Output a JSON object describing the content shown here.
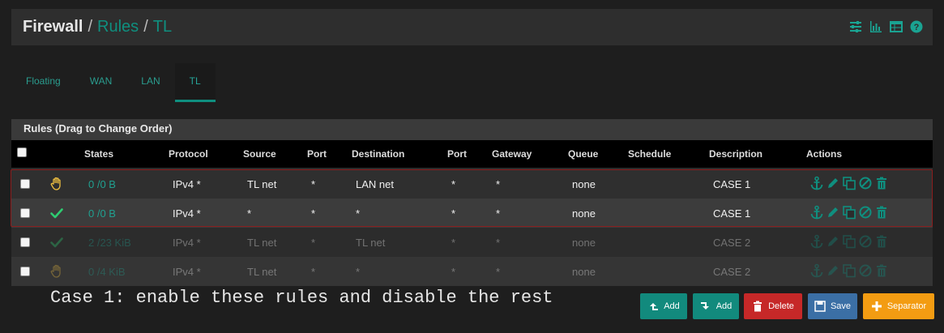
{
  "breadcrumb": {
    "first": "Firewall",
    "second": "Rules",
    "third": "TL",
    "sep": "/"
  },
  "header_icons": [
    "sliders-icon",
    "bar-chart-icon",
    "table-icon",
    "help-icon"
  ],
  "tabs": [
    {
      "label": "Floating"
    },
    {
      "label": "WAN"
    },
    {
      "label": "LAN"
    },
    {
      "label": "TL"
    }
  ],
  "panel": {
    "title": "Rules (Drag to Change Order)"
  },
  "columns": {
    "states": "States",
    "protocol": "Protocol",
    "source": "Source",
    "port": "Port",
    "destination": "Destination",
    "dport": "Port",
    "gateway": "Gateway",
    "queue": "Queue",
    "schedule": "Schedule",
    "description": "Description",
    "actions": "Actions"
  },
  "rows": [
    {
      "status_icon": "hand-block-icon",
      "states": "0 /0 B",
      "protocol": "IPv4 *",
      "source": "TL net",
      "port": "*",
      "destination": "LAN net",
      "dport": "*",
      "gateway": "*",
      "queue": "none",
      "schedule": "",
      "description": "CASE 1",
      "disabled": false
    },
    {
      "status_icon": "check-pass-icon",
      "states": "0 /0 B",
      "protocol": "IPv4 *",
      "source": "*",
      "port": "*",
      "destination": "*",
      "dport": "*",
      "gateway": "*",
      "queue": "none",
      "schedule": "",
      "description": "CASE 1",
      "disabled": false
    },
    {
      "status_icon": "check-pass-icon",
      "states": "2 /23 KiB",
      "protocol": "IPv4 *",
      "source": "TL net",
      "port": "*",
      "destination": "TL net",
      "dport": "*",
      "gateway": "*",
      "queue": "none",
      "schedule": "",
      "description": "CASE 2",
      "disabled": true
    },
    {
      "status_icon": "hand-block-icon",
      "states": "0 /4 KiB",
      "protocol": "IPv4 *",
      "source": "TL net",
      "port": "*",
      "destination": "*",
      "dport": "*",
      "gateway": "*",
      "queue": "none",
      "schedule": "",
      "description": "CASE 2",
      "disabled": true
    }
  ],
  "annotation": "Case 1: enable these rules and disable the rest",
  "buttons": {
    "add_top": "Add",
    "add_bottom": "Add",
    "delete": "Delete",
    "save": "Save",
    "separator": "Separator"
  },
  "colors": {
    "accent": "#0f8f7f",
    "pass": "#2ecc71",
    "block": "#f0c040",
    "danger": "#c62828",
    "warning": "#f39c12",
    "save": "#3b6fa5"
  }
}
